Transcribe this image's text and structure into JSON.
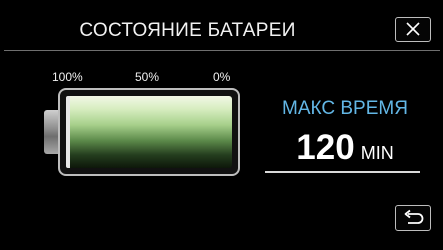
{
  "header": {
    "title": "СОСТОЯНИЕ БАТАРЕИ",
    "close_icon": "close-x-icon"
  },
  "battery": {
    "scale_labels": [
      "100%",
      "50%",
      "0%"
    ],
    "charge_fraction": 1.0,
    "fill_color": "#a7d08b"
  },
  "max_time": {
    "label": "МАКС ВРЕМЯ",
    "value": "120",
    "unit": "MIN",
    "label_color": "#63b7e6"
  },
  "footer": {
    "back_icon": "return-arrow-icon"
  }
}
